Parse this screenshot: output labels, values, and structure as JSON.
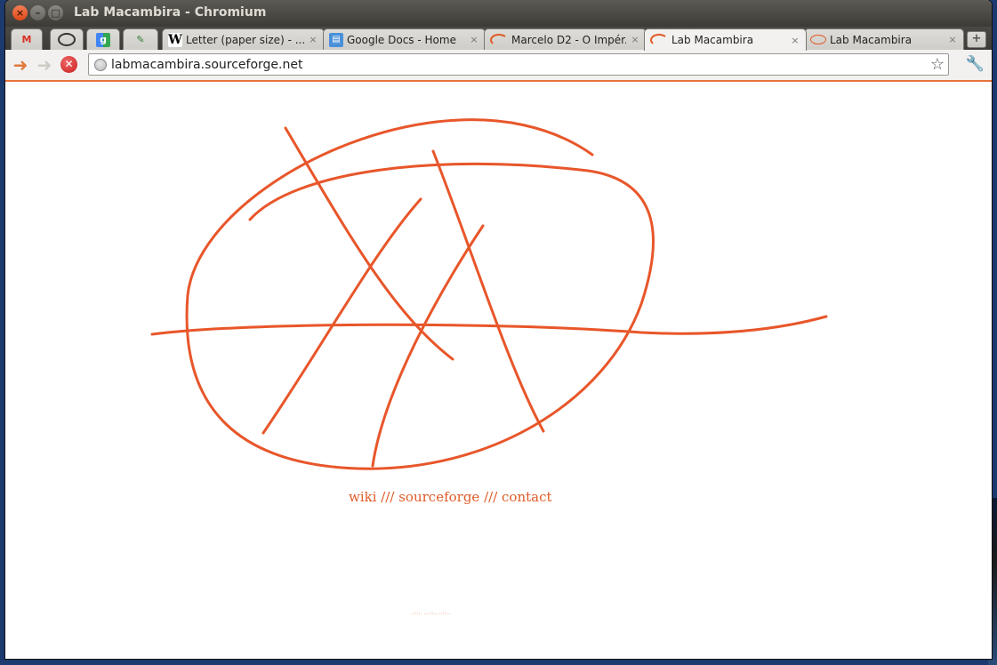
{
  "window": {
    "title": "Lab Macambira - Chromium"
  },
  "tabs": [
    {
      "icon": "gmail-icon",
      "label": ""
    },
    {
      "icon": "globe-badge-icon",
      "label": ""
    },
    {
      "icon": "google-icon",
      "label": ""
    },
    {
      "icon": "feather-icon",
      "label": ""
    },
    {
      "icon": "wikipedia-icon",
      "label": "Letter (paper size) - ..."
    },
    {
      "icon": "docs-icon",
      "label": "Google Docs - Home"
    },
    {
      "icon": "loading-icon",
      "label": "Marcelo D2 - O Impér..."
    },
    {
      "icon": "loading-icon",
      "label": "Lab Macambira"
    },
    {
      "icon": "macambira-icon",
      "label": "Lab Macambira"
    }
  ],
  "toolbar": {
    "url": "labmacambira.sourceforge.net"
  },
  "page": {
    "links": {
      "wiki": "wiki",
      "sep1": " /// ",
      "sourceforge": "sourceforge",
      "sep2": " /// ",
      "contact": "contact"
    },
    "footer": "..::.. ...::.. ..::.."
  },
  "colors": {
    "accent": "#e8562a"
  }
}
